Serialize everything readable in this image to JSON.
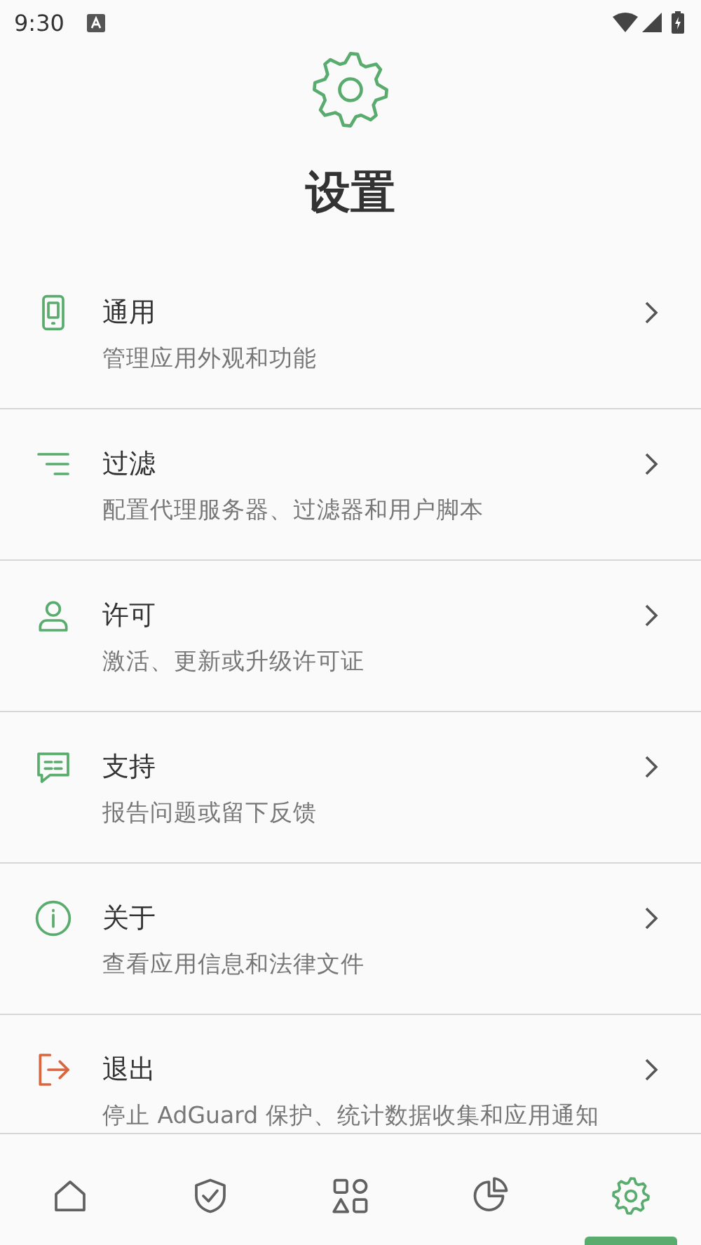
{
  "status_bar": {
    "time": "9:30"
  },
  "header": {
    "title": "设置"
  },
  "settings": [
    {
      "kind": "general",
      "title": "通用",
      "subtitle": "管理应用外观和功能"
    },
    {
      "kind": "filtering",
      "title": "过滤",
      "subtitle": "配置代理服务器、过滤器和用户脚本"
    },
    {
      "kind": "license",
      "title": "许可",
      "subtitle": "激活、更新或升级许可证"
    },
    {
      "kind": "support",
      "title": "支持",
      "subtitle": "报告问题或留下反馈"
    },
    {
      "kind": "about",
      "title": "关于",
      "subtitle": "查看应用信息和法律文件"
    },
    {
      "kind": "exit",
      "title": "退出",
      "subtitle": "停止 AdGuard 保护、统计数据收集和应用通知"
    }
  ],
  "bottom_nav": [
    {
      "kind": "home",
      "selected": false
    },
    {
      "kind": "protection",
      "selected": false
    },
    {
      "kind": "apps",
      "selected": false
    },
    {
      "kind": "statistics",
      "selected": false
    },
    {
      "kind": "settings",
      "selected": true
    }
  ]
}
